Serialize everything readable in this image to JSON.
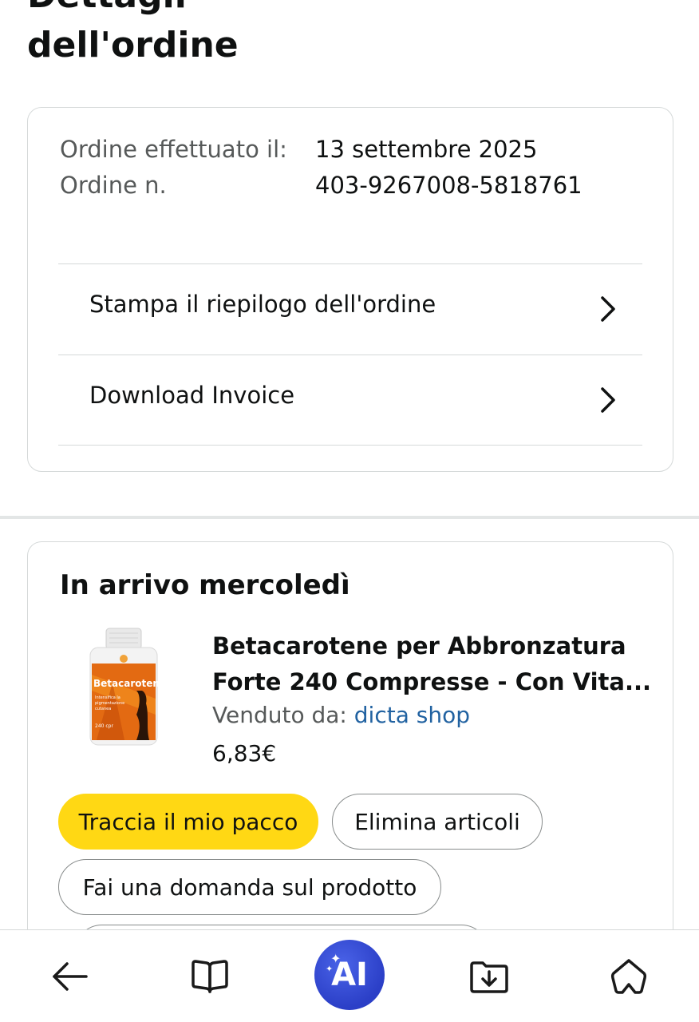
{
  "page": {
    "title_line1": "Dettagli",
    "title_line2": "dell'ordine"
  },
  "summary": {
    "order_date_label": "Ordine effettuato il:",
    "order_number_label": "Ordine n.",
    "order_date": "13 settembre 2025",
    "order_number": "403-9267008-5818761",
    "links": [
      {
        "label": "Stampa il riepilogo dell'ordine",
        "icon": "chevron-right-icon"
      },
      {
        "label": "Download Invoice",
        "icon": "chevron-right-icon"
      }
    ]
  },
  "shipment": {
    "arrival_title": "In arrivo mercoledì",
    "product": {
      "name": "Betacarotene per Abbronzatura Forte 240 Compresse - Con Vita...",
      "seller_label": "Venduto da:",
      "seller_name": "dicta shop",
      "price": "6,83€",
      "image_icon": "product-bottle-image"
    },
    "actions": {
      "track": "Traccia il mio pacco",
      "delete": "Elimina articoli",
      "ask": "Fai una domanda sul prodotto"
    }
  },
  "bottom_nav": {
    "back_icon": "back-arrow-icon",
    "reader_icon": "book-icon",
    "ai_label": "AI",
    "download_icon": "download-folder-icon",
    "home_icon": "home-icon"
  },
  "colors": {
    "primary_button": "#ffd814",
    "link": "#2162a1",
    "ai_button": "#3048d6",
    "border": "#d5d9d9",
    "muted_text": "#565959"
  }
}
